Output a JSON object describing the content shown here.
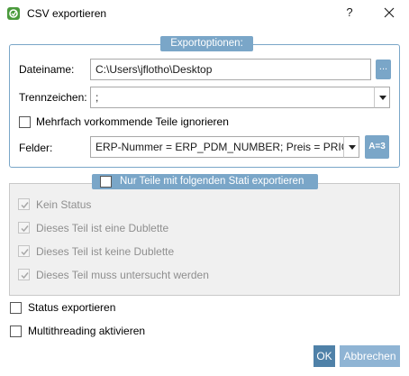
{
  "window": {
    "title": "CSV exportieren",
    "help_label": "?"
  },
  "export_options": {
    "legend": "Exportoptionen:",
    "filename_label": "Dateiname:",
    "filename_value": "C:\\Users\\jflotho\\Desktop",
    "browse_label": "...",
    "separator_label": "Trennzeichen:",
    "separator_value": ";",
    "ignore_duplicates_label": "Mehrfach vorkommende Teile ignorieren",
    "ignore_duplicates_checked": false,
    "fields_label": "Felder:",
    "fields_value": "ERP-Nummer = ERP_PDM_NUMBER; Preis = PRICE",
    "mapping_button_label": "A=3"
  },
  "status_filter": {
    "legend": "Nur Teile mit folgenden Stati exportieren",
    "enabled": false,
    "items": [
      {
        "label": "Kein Status",
        "checked": true
      },
      {
        "label": "Dieses Teil ist eine Dublette",
        "checked": true
      },
      {
        "label": "Dieses Teil ist keine Dublette",
        "checked": true
      },
      {
        "label": "Dieses Teil muss untersucht werden",
        "checked": true
      }
    ]
  },
  "options": {
    "export_status_label": "Status exportieren",
    "export_status_checked": false,
    "multithreading_label": "Multithreading aktivieren",
    "multithreading_checked": false
  },
  "buttons": {
    "ok_label": "OK",
    "cancel_label": "Abbrechen"
  },
  "colors": {
    "accent": "#7aa6c8",
    "ok_button": "#4f81a8",
    "disabled_text": "#8f8f8f"
  }
}
